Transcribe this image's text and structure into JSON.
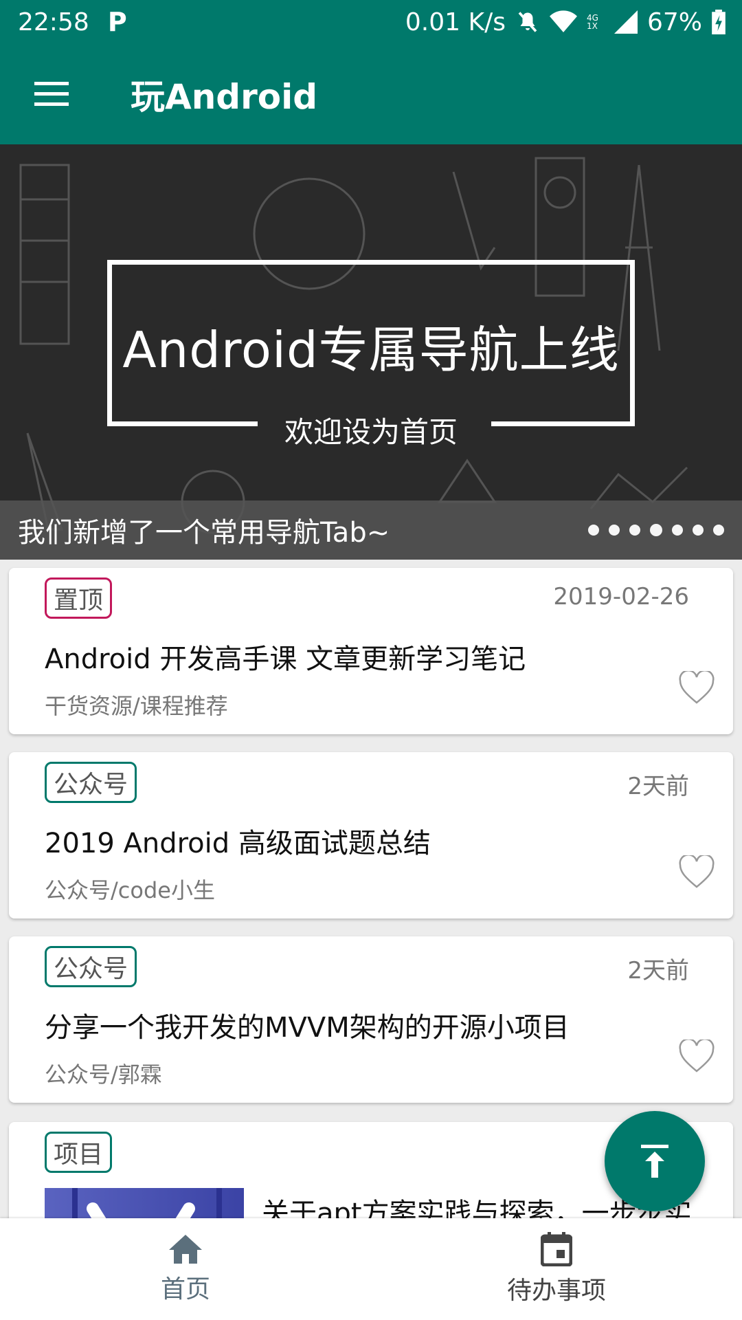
{
  "status_bar": {
    "time": "22:58",
    "speed": "0.01 K/s",
    "network": "4G 1X",
    "battery": "67%"
  },
  "app_bar": {
    "title": "玩Android",
    "menu_icon": "hamburger-menu-icon"
  },
  "banner": {
    "headline": "Android专属导航上线",
    "subheadline": "欢迎设为首页",
    "caption": "我们新增了一个常用导航Tab~",
    "dots_total": 7,
    "dots_active": 4
  },
  "articles": [
    {
      "tag": "置顶",
      "tag_color": "#c2185b",
      "date": "2019-02-26",
      "title": "Android 开发高手课 文章更新学习笔记",
      "chapter": "干货资源/课程推荐"
    },
    {
      "tag": "公众号",
      "tag_color": "#00796b",
      "date": "2天前",
      "title": "2019 Android 高级面试题总结",
      "chapter": "公众号/code小生"
    },
    {
      "tag": "公众号",
      "tag_color": "#00796b",
      "date": "2天前",
      "title": "分享一个我开发的MVVM架构的开源小项目",
      "chapter": "公众号/郭霖"
    },
    {
      "tag": "项目",
      "tag_color": "#00796b",
      "title": "关于apt方案实践与探索，一步步实"
    }
  ],
  "bottom_nav": {
    "home": "首页",
    "todo": "待办事项"
  },
  "colors": {
    "primary": "#00796b",
    "top_tag": "#c2185b"
  }
}
